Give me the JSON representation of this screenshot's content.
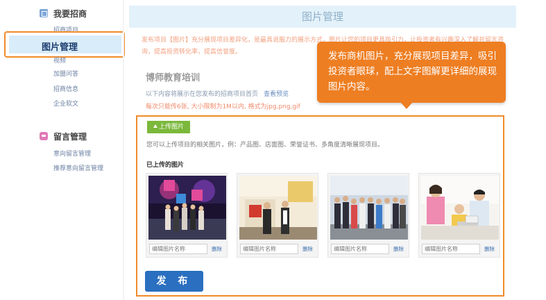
{
  "sidebar": {
    "section1": {
      "title": "我要招商",
      "icon": "tag-icon"
    },
    "items1": [
      "招商项目",
      "图片管理",
      "视频",
      "加盟问答",
      "招商信息",
      "企业软文"
    ],
    "active_item": "图片管理",
    "section2": {
      "title": "留言管理",
      "icon": "message-icon"
    },
    "items2": [
      "意向留言管理",
      "推荐意向留言管理"
    ]
  },
  "main": {
    "title": "图片管理",
    "description": "发布项目【图片】充分展现项目差异化，是最具说服力的展示方式，图片让您的项目更具吸引力，让投资者有兴趣深入了解并留言咨询，提高投资转化率，提高信誉度。",
    "company": "博师教育培训",
    "info_line": "以下内容将展示在您发布的招商项目首页",
    "preview_link": "查看预览",
    "limit_line": "每次只能传6张, 大小限制为1M以内, 格式为jpg,png,gif",
    "upload_button": "上传图片",
    "upload_hint": "您可以上传项目的相关图片，例：产品图、店面图、荣誉证书、多角度清晰展现项目。",
    "uploaded_label": "已上传的图片",
    "cards": [
      {
        "placeholder": "编辑图片名称",
        "delete": "删除"
      },
      {
        "placeholder": "编辑图片名称",
        "delete": "删除"
      },
      {
        "placeholder": "编辑图片名称",
        "delete": "删除"
      },
      {
        "placeholder": "编辑图片名称",
        "delete": "删除"
      }
    ],
    "publish_button": "发 布"
  },
  "tooltip": {
    "text": "发布商机图片，充分展现项目差异，吸引投资者眼球，配上文字图解更详细的展现图片内容。"
  },
  "colors": {
    "accent_orange": "#ee7e22",
    "publish_blue": "#2a6fc0",
    "upload_green": "#7bb83b",
    "active_bg": "#d9ecfa"
  }
}
